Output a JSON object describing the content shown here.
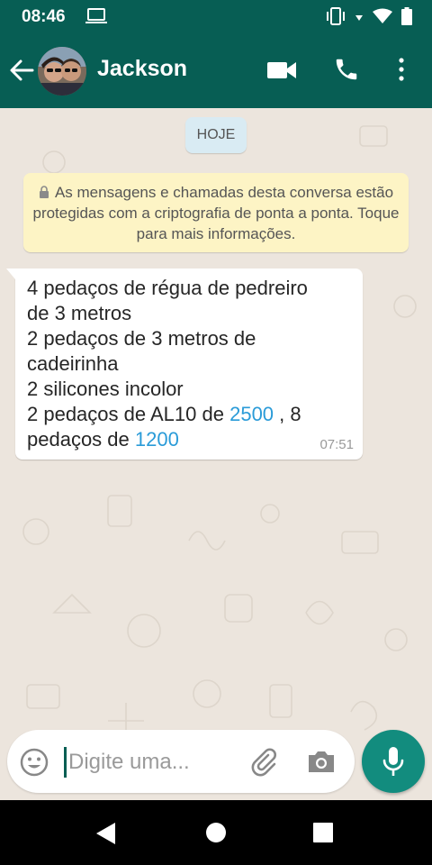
{
  "status_bar": {
    "time": "08:46",
    "left_icons": [
      "laptop-icon"
    ],
    "right_icons": [
      "vibrate-icon",
      "data-arrow-icon",
      "wifi-icon",
      "battery-icon"
    ]
  },
  "header": {
    "contact_name": "Jackson",
    "icons": [
      "back-arrow-icon",
      "avatar",
      "video-call-icon",
      "phone-icon",
      "more-vert-icon"
    ]
  },
  "chat": {
    "date_chip": "HOJE",
    "encryption_notice": "As mensagens e chamadas desta conversa estão protegidas com a criptografia de ponta a ponta. Toque para mais informações.",
    "message": {
      "lines": [
        "4 pedaços de régua de pedreiro",
        "de 3 metros",
        "2 pedaços de 3 metros de",
        "cadeirinha",
        "2 silicones incolor"
      ],
      "line6_prefix": "2 pedaços de AL10 de ",
      "line6_link": "2500",
      "line6_suffix": " , 8",
      "line7_prefix": "pedaços  de ",
      "line7_link": "1200",
      "time": "07:51"
    }
  },
  "input": {
    "placeholder": "Digite uma..."
  },
  "colors": {
    "header": "#075e54",
    "accent": "#128c7e",
    "link": "#2a9bd8",
    "chat_bg": "#ece5dd",
    "notice_bg": "#fdf4c5",
    "date_chip_bg": "#d9ebf3"
  }
}
